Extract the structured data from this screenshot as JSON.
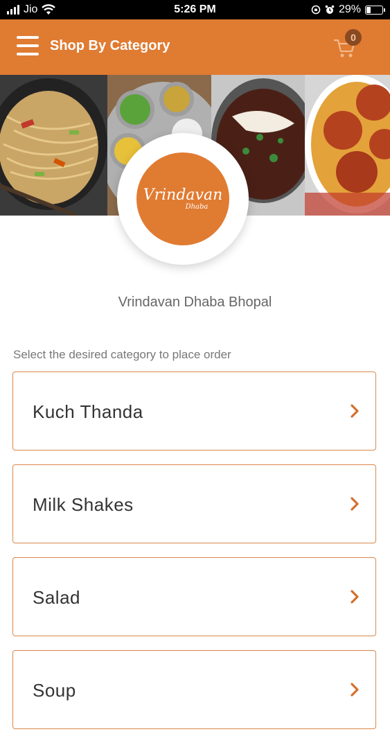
{
  "status_bar": {
    "carrier": "Jio",
    "time": "5:26 PM",
    "battery_percent": "29%",
    "battery_level": 0.29
  },
  "header": {
    "title": "Shop By Category",
    "cart_count": "0",
    "menu_icon": "hamburger-menu-icon",
    "cart_icon": "shopping-cart-icon"
  },
  "logo": {
    "main_text": "Vrindavan",
    "sub_text": "Dhaba"
  },
  "store": {
    "name": "Vrindavan Dhaba Bhopal"
  },
  "instruction": "Select the desired category to place order",
  "categories": [
    {
      "label": "Kuch Thanda"
    },
    {
      "label": "Milk Shakes"
    },
    {
      "label": "Salad"
    },
    {
      "label": "Soup"
    }
  ],
  "colors": {
    "accent": "#e07b32",
    "badge": "#8a4a21",
    "border": "#d9874a",
    "chevron": "#d3702e"
  }
}
